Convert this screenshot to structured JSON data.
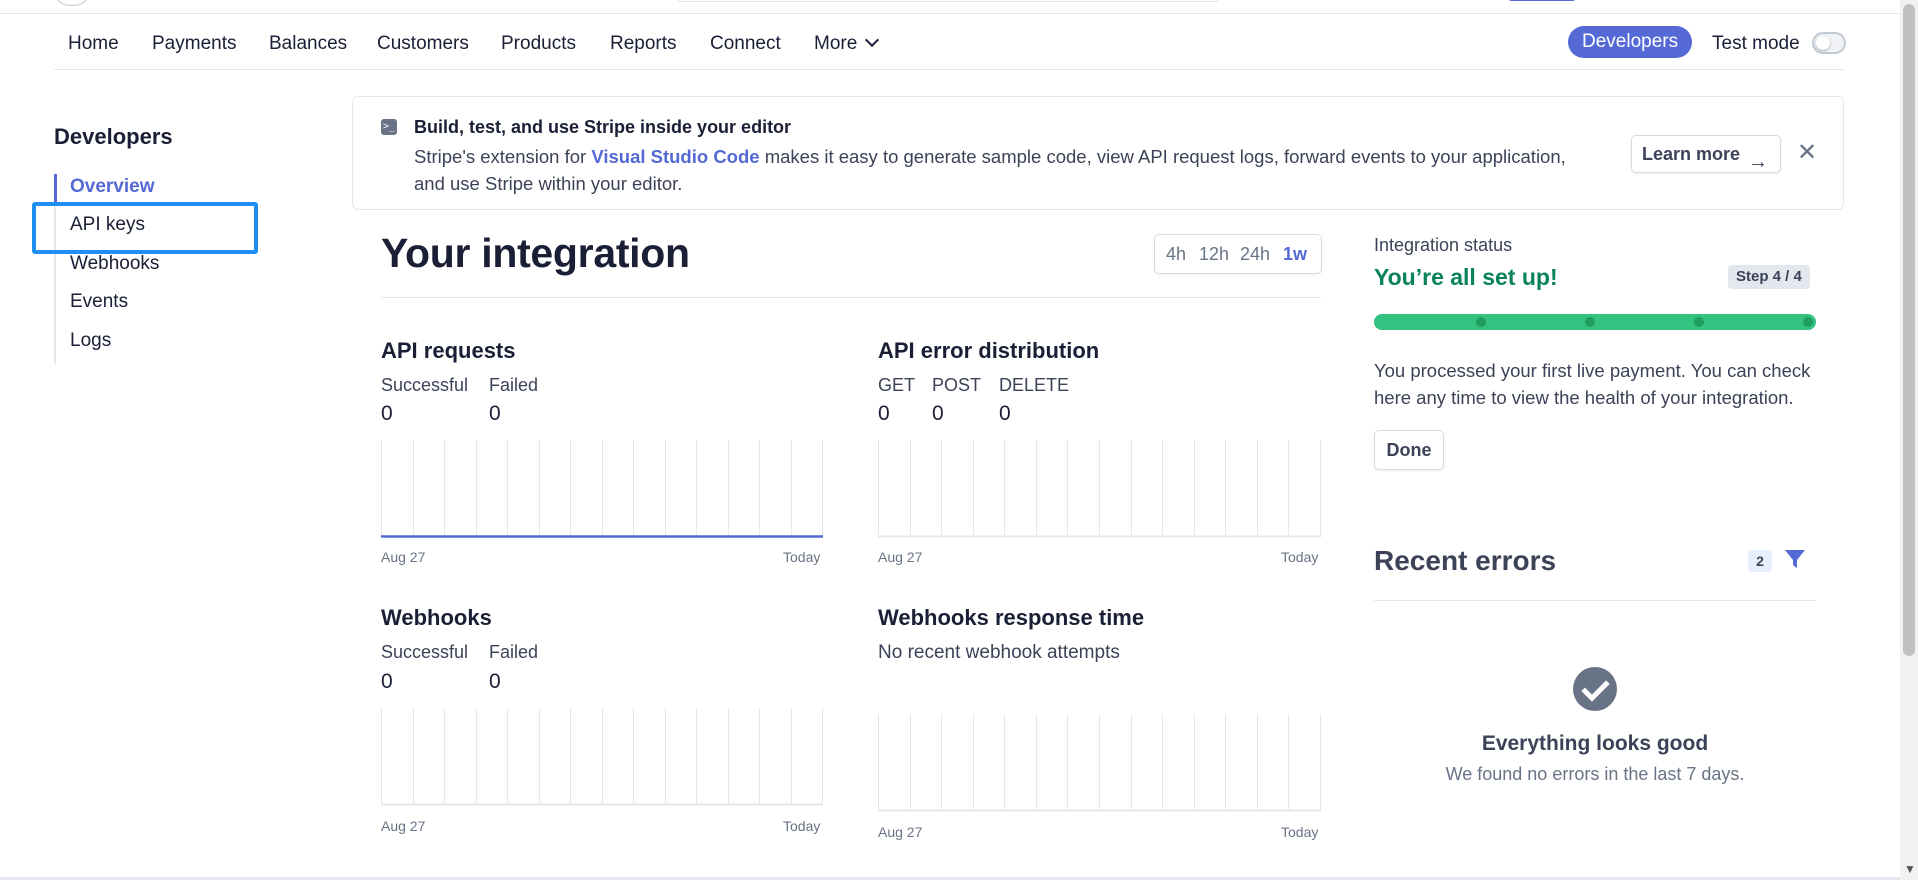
{
  "nav": {
    "items": [
      "Home",
      "Payments",
      "Balances",
      "Customers",
      "Products",
      "Reports",
      "Connect",
      "More"
    ],
    "developers": "Developers",
    "test_mode": "Test mode"
  },
  "sidebar": {
    "title": "Developers",
    "items": [
      {
        "label": "Overview",
        "active": true
      },
      {
        "label": "API keys",
        "active": false,
        "highlighted": true
      },
      {
        "label": "Webhooks",
        "active": false
      },
      {
        "label": "Events",
        "active": false
      },
      {
        "label": "Logs",
        "active": false
      }
    ]
  },
  "banner": {
    "title": "Build, test, and use Stripe inside your editor",
    "text_before": "Stripe's extension for ",
    "link": "Visual Studio Code",
    "text_after": " makes it easy to generate sample code, view API request logs, forward events to your application, and use Stripe within your editor.",
    "learn_more": "Learn more",
    "icon": "terminal-icon"
  },
  "integration": {
    "title": "Your integration",
    "ranges": [
      "4h",
      "12h",
      "24h",
      "1w"
    ],
    "selected_range": "1w"
  },
  "panels": {
    "api_requests": {
      "title": "API requests",
      "metrics": [
        {
          "label": "Successful",
          "value": "0"
        },
        {
          "label": "Failed",
          "value": "0"
        }
      ],
      "x_start": "Aug 27",
      "x_end": "Today"
    },
    "api_errors": {
      "title": "API error distribution",
      "metrics": [
        {
          "label": "GET",
          "value": "0"
        },
        {
          "label": "POST",
          "value": "0"
        },
        {
          "label": "DELETE",
          "value": "0"
        }
      ],
      "x_start": "Aug 27",
      "x_end": "Today"
    },
    "webhooks": {
      "title": "Webhooks",
      "metrics": [
        {
          "label": "Successful",
          "value": "0"
        },
        {
          "label": "Failed",
          "value": "0"
        }
      ],
      "x_start": "Aug 27",
      "x_end": "Today"
    },
    "webhooks_response": {
      "title": "Webhooks response time",
      "message": "No recent webhook attempts",
      "x_start": "Aug 27",
      "x_end": "Today"
    }
  },
  "status": {
    "label": "Integration status",
    "headline": "You’re all set up!",
    "step": "Step 4 / 4",
    "progress": 1.0,
    "description": "You processed your first live payment. You can check here any time to view the health of your integration.",
    "done": "Done"
  },
  "recent_errors": {
    "title": "Recent errors",
    "count": "2",
    "empty_title": "Everything looks good",
    "empty_sub": "We found no errors in the last 7 days."
  },
  "colors": {
    "accent": "#5469d4",
    "success": "#09825d",
    "progress": "#33c27f",
    "highlight": "#1e8ff0"
  }
}
